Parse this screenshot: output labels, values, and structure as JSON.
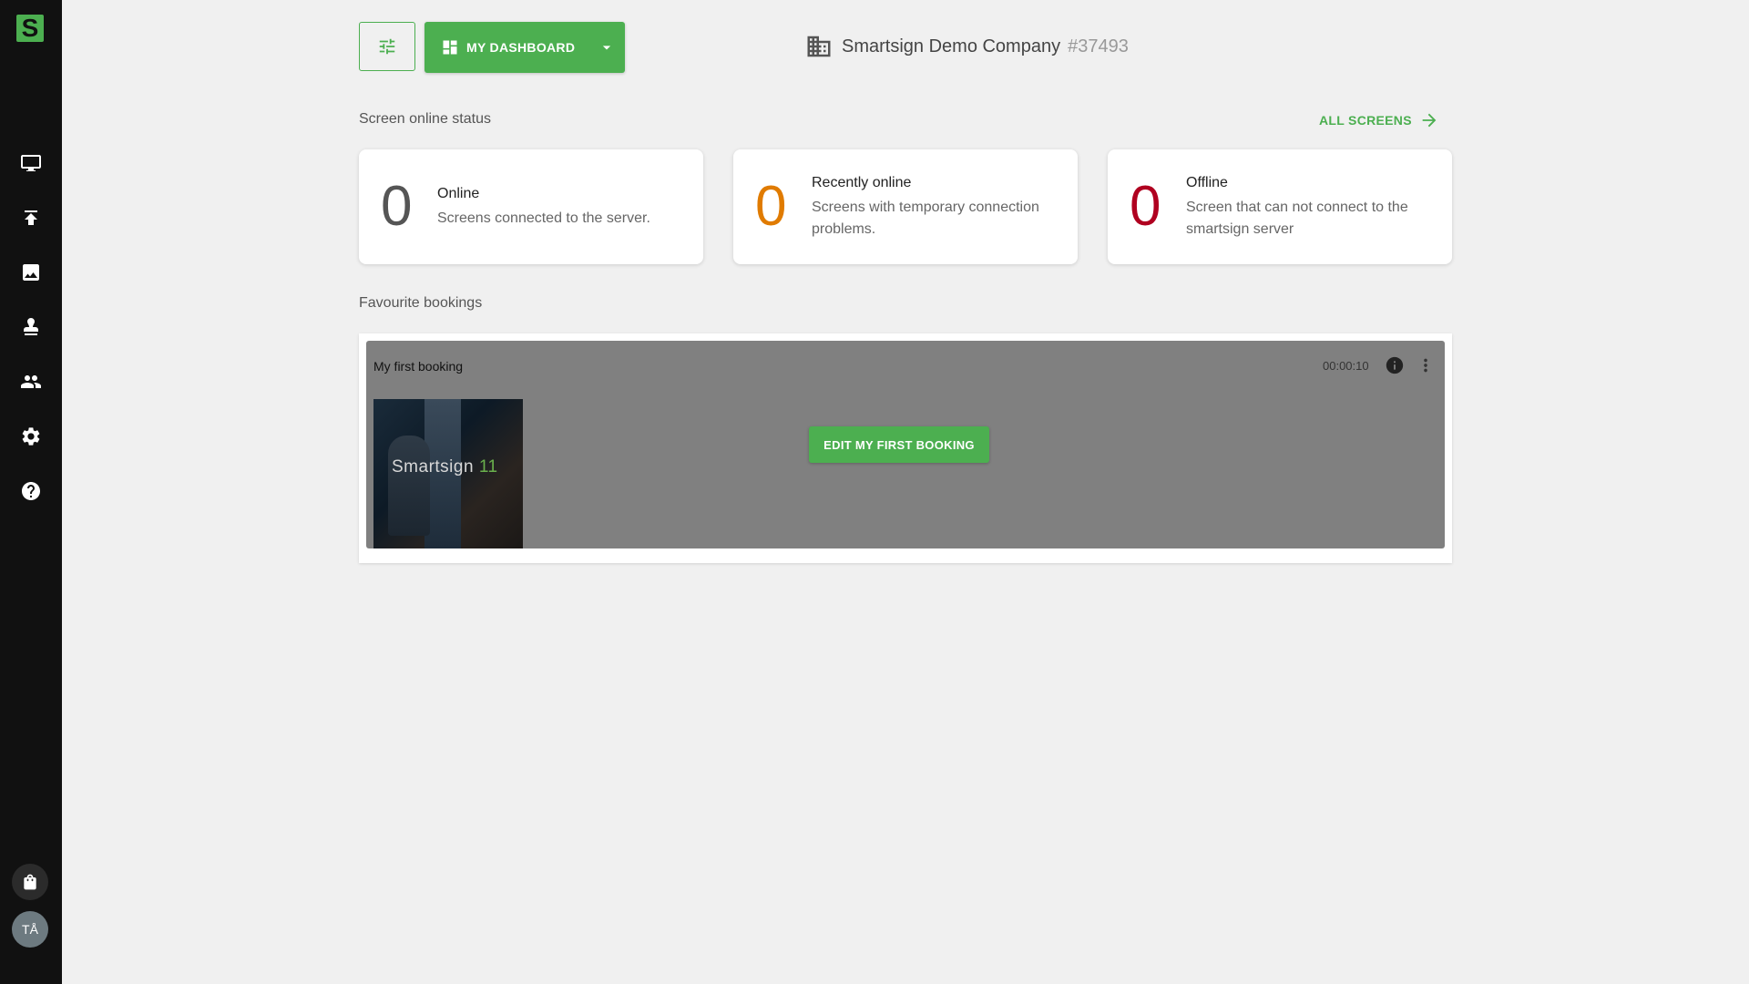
{
  "sidebar": {
    "logo_text": "S",
    "items": [
      {
        "name": "screens",
        "icon": "monitor-icon"
      },
      {
        "name": "publish",
        "icon": "upload-icon"
      },
      {
        "name": "media",
        "icon": "image-icon"
      },
      {
        "name": "bookings",
        "icon": "stamp-icon"
      },
      {
        "name": "users",
        "icon": "people-icon"
      },
      {
        "name": "settings",
        "icon": "gear-icon"
      },
      {
        "name": "help",
        "icon": "help-icon"
      }
    ],
    "bag_icon": "shopping-bag-icon",
    "avatar_initials": "TÅ"
  },
  "toolbar": {
    "filter_icon": "tune-icon",
    "dashboard_label": "MY DASHBOARD",
    "dashboard_icon": "dashboard-icon"
  },
  "company": {
    "name": "Smartsign Demo Company",
    "id": "#37493",
    "icon": "building-icon"
  },
  "screen_status": {
    "title": "Screen online status",
    "all_screens_label": "ALL SCREENS",
    "cards": [
      {
        "count": "0",
        "title": "Online",
        "description": "Screens connected to the server.",
        "color": "#555555"
      },
      {
        "count": "0",
        "title": "Recently online",
        "description": "Screens with temporary connection problems.",
        "color": "#e07b00"
      },
      {
        "count": "0",
        "title": "Offline",
        "description": "Screen that can not connect to the smartsign server",
        "color": "#b00020"
      }
    ]
  },
  "favourites": {
    "title": "Favourite bookings",
    "booking": {
      "title": "My first booking",
      "duration": "00:00:10",
      "thumb_brand": "Smartsign",
      "thumb_brand_num": "11",
      "edit_label": "EDIT MY FIRST BOOKING"
    }
  },
  "colors": {
    "accent": "#4caf50",
    "sidebar": "#111111",
    "background": "#f0f0f0"
  }
}
